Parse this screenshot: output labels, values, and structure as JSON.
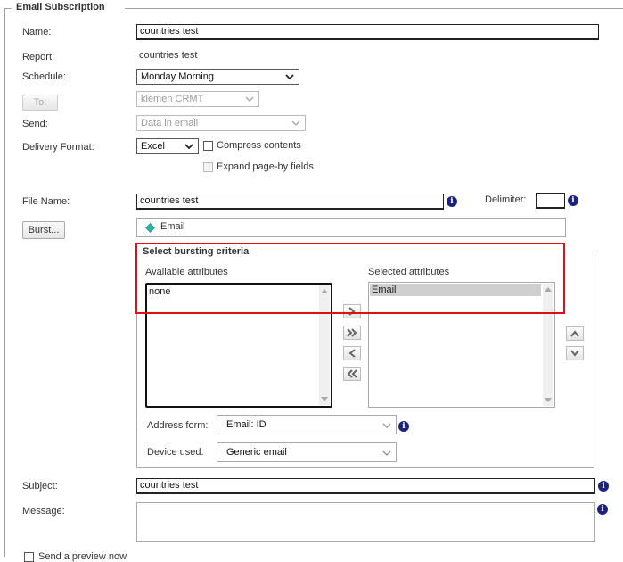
{
  "section": {
    "title": "Email Subscription"
  },
  "form": {
    "name_label": "Name:",
    "name_value": "countries test",
    "report_label": "Report:",
    "report_value": "countries test",
    "schedule_label": "Schedule:",
    "schedule_value": "Monday Morning",
    "to_button": "To:",
    "to_value": "klemen CRMT",
    "send_label": "Send:",
    "send_value": "Data in email",
    "delivery_label": "Delivery Format:",
    "delivery_value": "Excel",
    "compress_label": "Compress contents",
    "expand_label": "Expand page-by fields",
    "filename_label": "File Name:",
    "filename_value": "countries test",
    "delimiter_label": "Delimiter:",
    "delimiter_value": "",
    "burst_button": "Burst...",
    "burst_selected": "Email",
    "subject_label": "Subject:",
    "subject_value": "countries test",
    "message_label": "Message:",
    "message_value": "",
    "preview_label": "Send a preview now"
  },
  "bursting": {
    "title": "Select bursting criteria",
    "available_label": "Available attributes",
    "available_items": [
      "none"
    ],
    "selected_label": "Selected attributes",
    "selected_items": [
      "Email"
    ],
    "address_label": "Address form:",
    "address_value": "Email: ID",
    "device_label": "Device used:",
    "device_value": "Generic email"
  },
  "colors": {
    "highlight": "#e01010",
    "info": "#1a237e",
    "diamond": "#2bb5a0"
  },
  "icons": [
    "info-icon",
    "chevron-down-icon",
    "diamond-icon",
    "arrow-right-icon",
    "double-arrow-right-icon",
    "arrow-left-icon",
    "double-arrow-left-icon",
    "arrow-up-icon",
    "arrow-down-icon"
  ]
}
